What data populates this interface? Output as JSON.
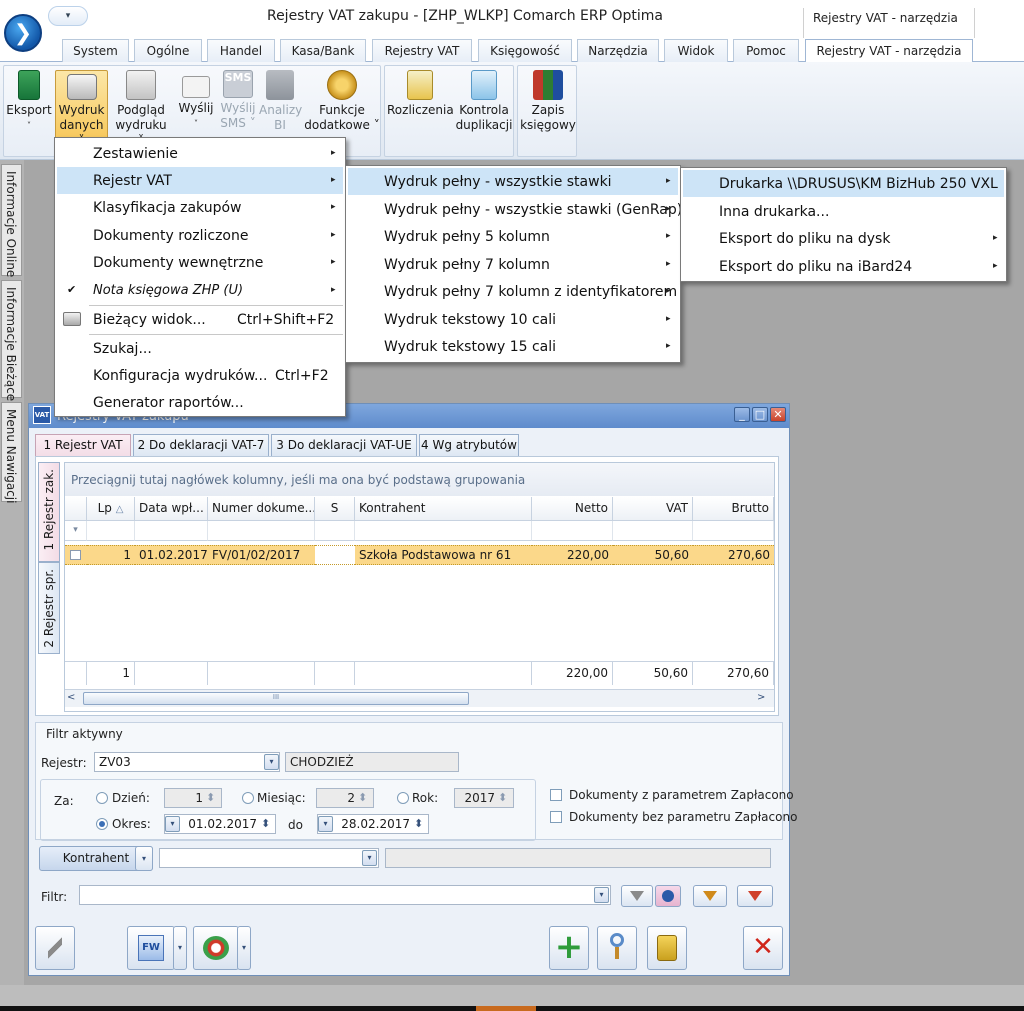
{
  "app": {
    "title": "Rejestry VAT zakupu - [ZHP_WLKP] Comarch ERP Optima",
    "context_group": "Rejestry VAT - narzędzia",
    "qat_glyph": "▾"
  },
  "ribbon_tabs": [
    "System",
    "Ogólne",
    "Handel",
    "Kasa/Bank",
    "Rejestry VAT",
    "Księgowość",
    "Narzędzia",
    "Widok",
    "Pomoc",
    "Rejestry VAT - narzędzia"
  ],
  "ribbon_buttons": {
    "eksport": {
      "label1": "Eksport",
      "label2": "˅"
    },
    "wydruk": {
      "label1": "Wydruk",
      "label2": "danych ˅"
    },
    "podglad": {
      "label1": "Podgląd",
      "label2": "wydruku ˅"
    },
    "wyslij": {
      "label1": "Wyślij",
      "label2": "˅"
    },
    "wyslij_sms": {
      "label1": "Wyślij",
      "label2": "SMS ˅",
      "icon_text": "SMS"
    },
    "analizy": {
      "label1": "Analizy",
      "label2": "BI"
    },
    "funkcje": {
      "label1": "Funkcje",
      "label2": "dodatkowe ˅"
    },
    "rozliczenia": {
      "label1": "Rozliczenia",
      "label2": ""
    },
    "kontrola": {
      "label1": "Kontrola",
      "label2": "duplikacji"
    },
    "zapis": {
      "label1": "Zapis",
      "label2": "księgowy"
    }
  },
  "side_tabs": [
    "Informacje Online",
    "Informacje Bieżące",
    "Menu Nawigacji"
  ],
  "menu_level1": {
    "items": [
      "Zestawienie",
      "Rejestr VAT",
      "Klasyfikacja zakupów",
      "Dokumenty rozliczone",
      "Dokumenty wewnętrzne",
      "Nota księgowa ZHP (U)",
      "Bieżący widok...",
      "Szukaj...",
      "Konfiguracja wydruków...",
      "Generator raportów..."
    ],
    "shortcuts": {
      "biezacy": "Ctrl+Shift+F2",
      "konfiguracja": "Ctrl+F2"
    },
    "check": "✔"
  },
  "menu_level2": {
    "items": [
      "Wydruk pełny - wszystkie stawki",
      "Wydruk pełny - wszystkie stawki (GenRap)",
      "Wydruk pełny 5 kolumn",
      "Wydruk pełny 7 kolumn",
      "Wydruk pełny 7 kolumn z identyfikatorem",
      "Wydruk tekstowy 10 cali",
      "Wydruk tekstowy 15 cali"
    ]
  },
  "menu_level3": {
    "items": [
      "Drukarka \\\\DRUSUS\\KM BizHub 250 VXL",
      "Inna drukarka...",
      "Eksport do pliku na dysk",
      "Eksport do pliku na iBard24"
    ]
  },
  "child_window": {
    "title": "Rejestry VAT zakupu",
    "icon_text": "VAT",
    "min": "_",
    "max": "□",
    "close": "✕",
    "tabs": [
      "1 Rejestr VAT",
      "2 Do deklaracji VAT-7",
      "3 Do deklaracji VAT-UE",
      "4 Wg atrybutów"
    ],
    "vtabs": [
      "1 Rejestr zak.",
      "2 Rejestr spr."
    ]
  },
  "grid": {
    "group_hint": "Przeciągnij tutaj nagłówek kolumny, jeśli ma ona być podstawą grupowania",
    "columns": [
      "Lp",
      "Data wpł...",
      "Numer dokume...",
      "S",
      "Kontrahent",
      "Netto",
      "VAT",
      "Brutto"
    ],
    "sort_glyph": "△",
    "filter_glyph": "▾",
    "rows": [
      {
        "lp": "1",
        "data": "01.02.2017",
        "numer": "FV/01/02/2017",
        "s": "",
        "kontrahent": "Szkoła Podstawowa nr 61",
        "netto": "220,00",
        "vat": "50,60",
        "brutto": "270,60"
      }
    ],
    "summary": {
      "count": "1",
      "netto": "220,00",
      "vat": "50,60",
      "brutto": "270,60"
    },
    "scroll": {
      "left": "<",
      "right": ">",
      "thumb": "III"
    }
  },
  "filter": {
    "title": "Filtr aktywny",
    "rejestr_label": "Rejestr:",
    "rejestr_value": "ZV03",
    "rejestr_name": "CHODZIEŻ",
    "za_label": "Za:",
    "dzien_label": "Dzień:",
    "dzien_value": "1",
    "miesiac_label": "Miesiąc:",
    "miesiac_value": "2",
    "rok_label": "Rok:",
    "rok_value": "2017",
    "okres_label": "Okres:",
    "okres_from": "01.02.2017",
    "do_label": "do",
    "okres_to": "28.02.2017",
    "chk_zaplacono": "Dokumenty z parametrem Zapłacono",
    "chk_bez": "Dokumenty bez parametru Zapłacono",
    "kontrahent_btn": "Kontrahent",
    "kontrahent_value": "",
    "filtr_label": "Filtr:",
    "filtr_value": ""
  },
  "bottom_buttons": {
    "fw": "FW",
    "add": "+",
    "close": "✕"
  },
  "dd_glyph": "▾",
  "spin_glyph": "⬍",
  "submenu_arrow": "▸",
  "colors": {
    "highlight": "#cde4f7",
    "row_selected": "#fbd88a",
    "active_tab": "#fbeef4",
    "title_blue": "#5e8bcc"
  }
}
